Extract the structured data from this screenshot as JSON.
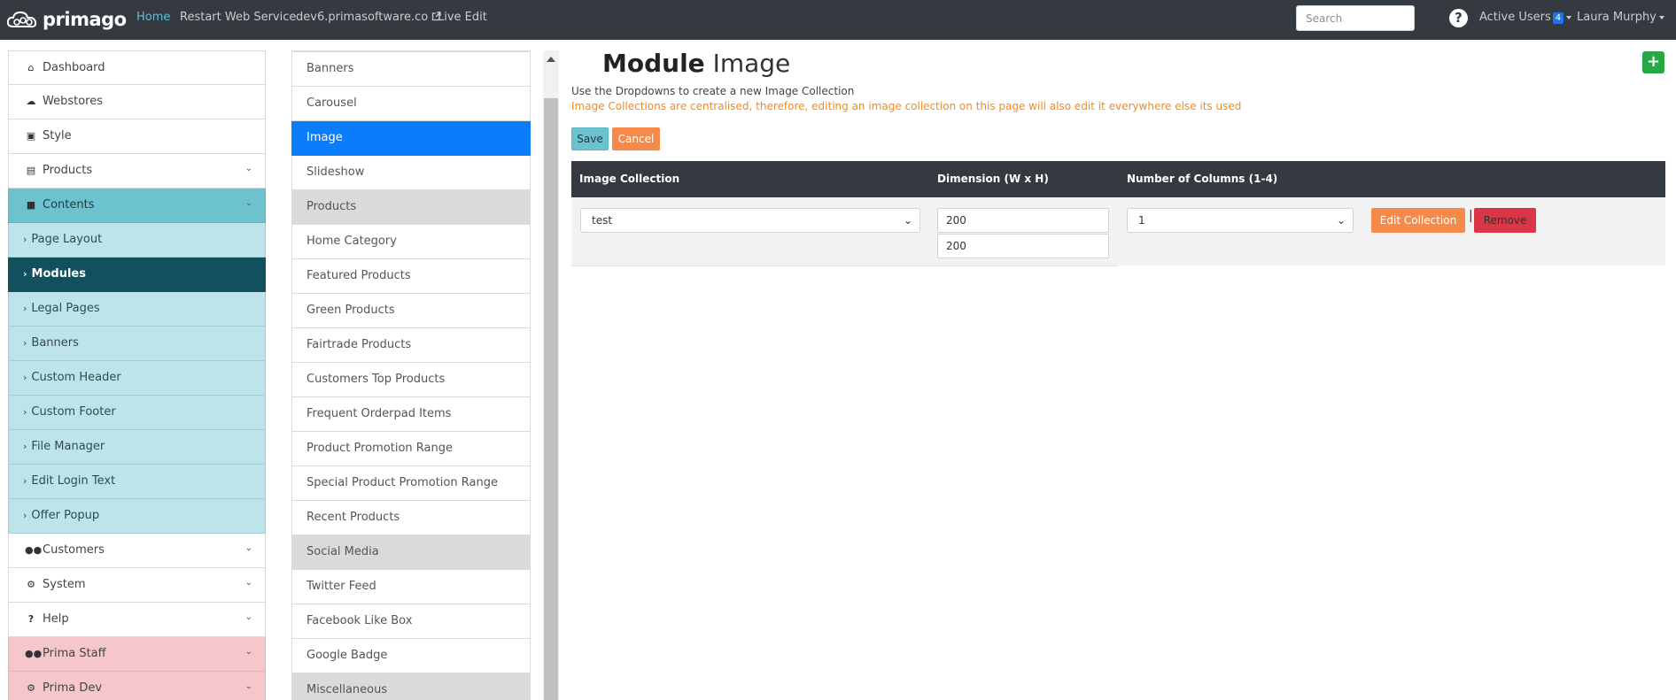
{
  "nav": {
    "logo": "primago",
    "links": [
      "Home",
      "Restart Web Service",
      "dev6.primasoftware.co",
      "Live Edit"
    ],
    "search_placeholder": "Search",
    "active_users_label": "Active Users",
    "active_users_count": "4",
    "user_name": "Laura Murphy"
  },
  "sidebar": {
    "items_top": [
      {
        "label": "Dashboard",
        "icon": "home-icon"
      },
      {
        "label": "Webstores",
        "icon": "cloud-icon"
      },
      {
        "label": "Style",
        "icon": "image-icon"
      },
      {
        "label": "Products",
        "icon": "list-icon"
      },
      {
        "label": "Contents",
        "icon": "folder-icon"
      }
    ],
    "contents_sub": [
      "Page Layout",
      "Modules",
      "Legal Pages",
      "Banners",
      "Custom Header",
      "Custom Footer",
      "File Manager",
      "Edit Login Text",
      "Offer Popup"
    ],
    "items_bottom": [
      {
        "label": "Customers",
        "icon": "users-icon"
      },
      {
        "label": "System",
        "icon": "gear-icon"
      },
      {
        "label": "Help",
        "icon": "question-icon"
      },
      {
        "label": "Prima Staff",
        "icon": "users-icon"
      },
      {
        "label": "Prima Dev",
        "icon": "gear-icon"
      }
    ]
  },
  "modules": [
    "Banners",
    "Carousel",
    "Image",
    "Slideshow",
    "Products",
    "Home Category",
    "Featured Products",
    "Green Products",
    "Fairtrade Products",
    "Customers Top Products",
    "Frequent Orderpad Items",
    "Product Promotion Range",
    "Special Product Promotion Range",
    "Recent Products",
    "Social Media",
    "Twitter Feed",
    "Facebook Like Box",
    "Google Badge",
    "Miscellaneous"
  ],
  "main": {
    "title_bold": "Module",
    "title_rest": "Image",
    "hint": "Use the Dropdowns to create a new Image Collection",
    "warning": "Image Collections are centralised, therefore, editing an image collection on this page will also edit it everywhere else its used",
    "save_label": "Save",
    "cancel_label": "Cancel",
    "table": {
      "headers": [
        "Image Collection",
        "Dimension (W x H)",
        "Number of Columns (1-4)"
      ],
      "row": {
        "collection": "test",
        "width": "200",
        "height": "200",
        "columns": "1",
        "edit_label": "Edit Collection",
        "separator": "|",
        "remove_label": "Remove"
      }
    }
  }
}
